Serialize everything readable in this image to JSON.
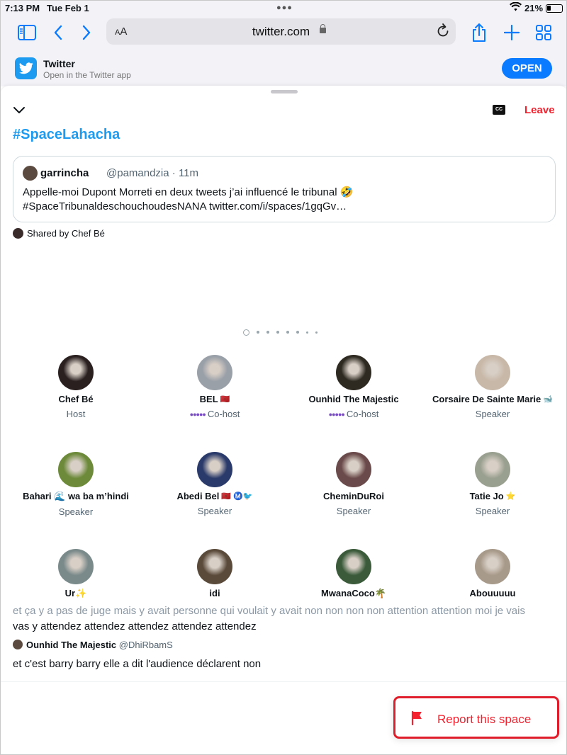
{
  "status_bar": {
    "time": "7:13 PM",
    "date": "Tue Feb 1",
    "battery": "21%"
  },
  "browser": {
    "domain": "twitter.com",
    "aa_label_small": "A",
    "aa_label_big": "A"
  },
  "app_banner": {
    "name": "Twitter",
    "subtitle": "Open in the Twitter app",
    "open_label": "OPEN"
  },
  "space": {
    "leave_label": "Leave",
    "cc_label": "CC",
    "title": "#SpaceLahacha",
    "pinned_tweet": {
      "author": "garrincha",
      "handle": "@pamandzia · 11m",
      "line1": "Appelle-moi Dupont Morreti en deux tweets j’ai influencé le tribunal 🤣",
      "line2": "#SpaceTribunaldeschouchoudesNANA twitter.com/i/spaces/1gqGv…"
    },
    "shared_by": "Shared by Chef Bé"
  },
  "speakers": [
    {
      "name": "Chef Bé",
      "badge": "",
      "role": "Host",
      "av": "#2a2020"
    },
    {
      "name": "BEL",
      "badge": "🇲🇦",
      "role": "Co-host",
      "av": "#9aa0a8"
    },
    {
      "name": "Ounhid The Majestic",
      "badge": "",
      "role": "Co-host",
      "av": "#2e2a22"
    },
    {
      "name": "Corsaire De Sainte Marie",
      "badge": "🐋",
      "role": "Speaker",
      "av": "#c8b8a8"
    },
    {
      "name": "Bahari 🌊 wa ba m’hindi",
      "badge": "",
      "role": "Speaker",
      "av": "#6d8a3a"
    },
    {
      "name": "Abedi Bel",
      "badge": "🇲🇦 Ⓜ️🐦",
      "role": "Speaker",
      "av": "#2a3a6a"
    },
    {
      "name": "CheminDuRoi",
      "badge": "",
      "role": "Speaker",
      "av": "#6a4a4a"
    },
    {
      "name": "Tatie Jo",
      "badge": "⭐",
      "role": "Speaker",
      "av": "#9aa090"
    },
    {
      "name": "Ur✨",
      "badge": "",
      "role": "",
      "av": "#7a8a8a"
    },
    {
      "name": "idi",
      "badge": "",
      "role": "",
      "av": "#5a4a3a"
    },
    {
      "name": "MwanaCoco🌴",
      "badge": "",
      "role": "",
      "av": "#3a5a3a"
    },
    {
      "name": "Abouuuuu",
      "badge": "",
      "role": "",
      "av": "#a89a8a"
    }
  ],
  "captions": {
    "faded_line": "et ça y a pas de juge mais y avait personne qui voulait y avait non non non non attention attention moi je vais",
    "line1": "vas y attendez attendez attendez attendez attendez",
    "speaker_name": "Ounhid The Majestic",
    "speaker_handle": "@DhiRbamS",
    "line2": "et c'est barry barry elle a dit l'audience déclarent non"
  },
  "report": {
    "label": "Report this space"
  },
  "colors": {
    "accent": "#1d9bf0",
    "danger": "#f4212e",
    "ios_blue": "#0a7aff"
  }
}
